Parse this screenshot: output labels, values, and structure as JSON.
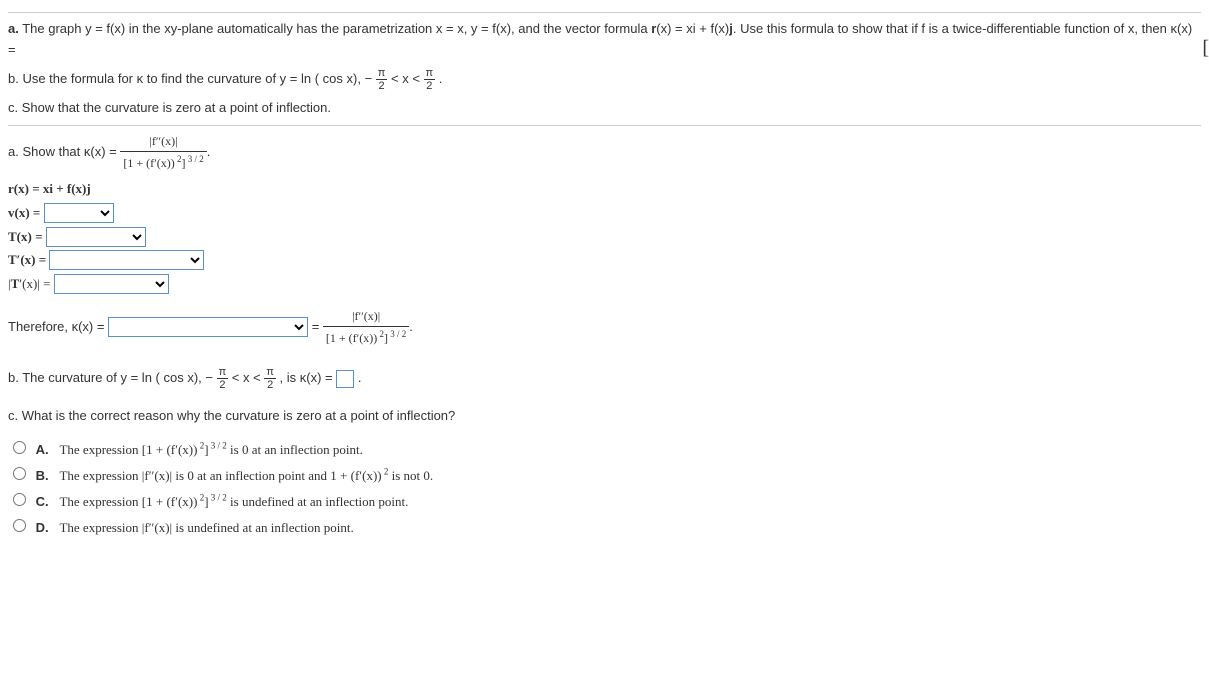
{
  "intro": {
    "a": "a. The graph y = f(x) in the xy-plane automatically has the parametrization x = x, y = f(x), and the vector formula r(x) = xi + f(x)j. Use this formula to show that if f is a twice-differentiable function of x, then κ(x) = ",
    "b_pre": "b. Use the formula for κ to find the curvature of y = ln ( cos x),  − ",
    "b_mid": " < x < ",
    "b_post": ".",
    "c": "c. Show that the curvature is zero at a point of inflection.",
    "pi": "π",
    "two": "2"
  },
  "partA": {
    "lead": "a. Show that κ(x) = ",
    "num": "|f′′(x)|",
    "den_pre": "[1 + (f′(x))",
    "den_sup": " 2",
    "den_mid": "]",
    "den_sup2": " 3 / 2",
    "den_post": ".",
    "l1": "r(x) = xi + f(x)j",
    "l2": "v(x) = ",
    "l3": "T(x) = ",
    "l4": "T′(x) = ",
    "l5": "|T′(x)| = ",
    "therefore": "Therefore, κ(x) = ",
    "equals": " = "
  },
  "partB": {
    "pre": "b. The curvature of y = ln ( cos x),  − ",
    "mid": " < x < ",
    "post": ", is κ(x) = ",
    "end": "."
  },
  "partC": {
    "q": "c. What is the correct reason why the curvature is zero at a point of inflection?",
    "optA_label": "A.",
    "optA_text1": "The expression [1 + (f′(x))",
    "optA_sup1": " 2",
    "optA_text2": "]",
    "optA_sup2": " 3 / 2",
    "optA_text3": " is 0 at an inflection point.",
    "optB_label": "B.",
    "optB_text1": "The expression |f′′(x)| is 0 at an inflection point and 1 + (f′(x))",
    "optB_sup": " 2",
    "optB_text2": " is not 0.",
    "optC_label": "C.",
    "optC_text1": "The expression [1 + (f′(x))",
    "optC_sup1": " 2",
    "optC_text2": "]",
    "optC_sup2": " 3 / 2",
    "optC_text3": " is undefined at an inflection point.",
    "optD_label": "D.",
    "optD_text": "The expression |f′′(x)| is undefined at an inflection point."
  },
  "cutoff": "["
}
